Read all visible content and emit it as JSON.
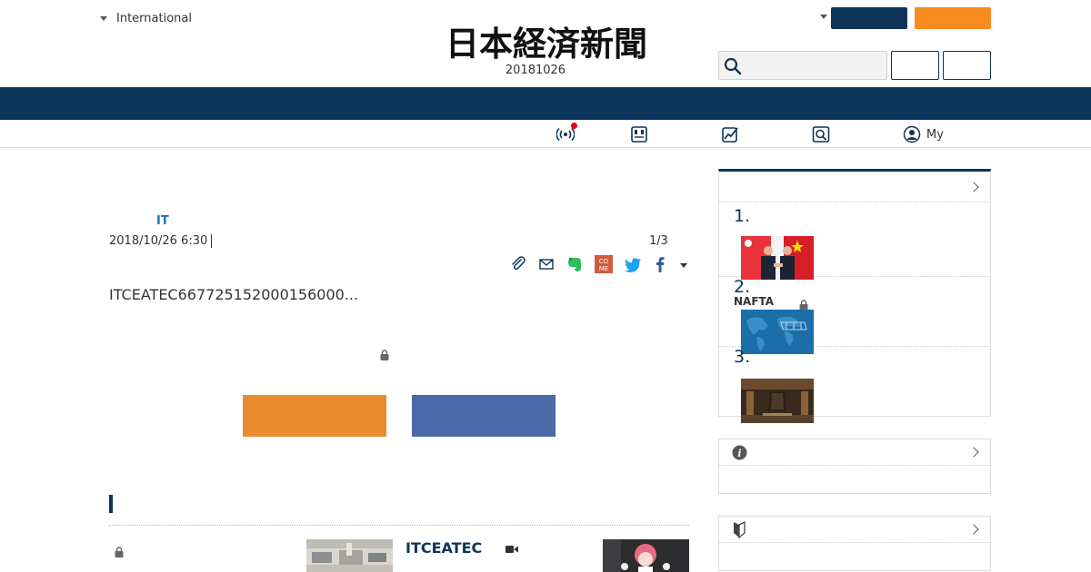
{
  "header": {
    "edition_label": "International",
    "logo_text": "日本経済新聞",
    "date": "20181026",
    "search_placeholder": ""
  },
  "toolbar": {
    "my_label": "My"
  },
  "article": {
    "category": "IT",
    "published": "2018/10/26 6:30",
    "pager": "1/3",
    "lead": "ITCEATEC667725152000156000..."
  },
  "related": {
    "title": "ITCEATEC"
  },
  "ranking": {
    "items": [
      {
        "rank": "1.",
        "label": ""
      },
      {
        "rank": "2.",
        "label": "NAFTA"
      },
      {
        "rank": "3.",
        "label": ""
      }
    ]
  },
  "colors": {
    "navy": "#0d3459",
    "orange": "#f68b1f",
    "cta_orange": "#ea8c2e",
    "cta_blue": "#4a6aaa",
    "category_blue": "#1477b5",
    "alert_red": "#e60012"
  }
}
